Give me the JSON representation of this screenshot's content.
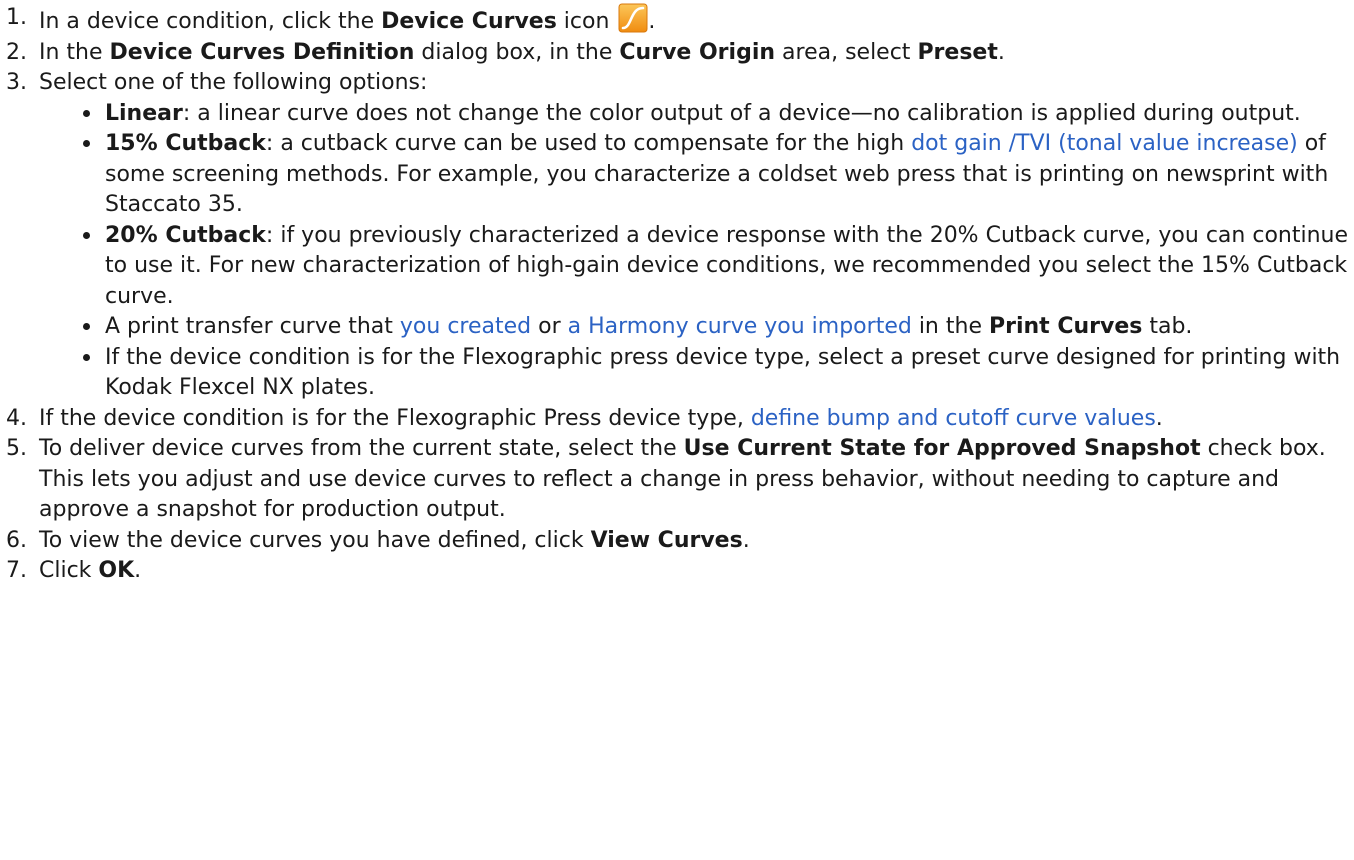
{
  "steps": [
    {
      "num": "1.",
      "t0": "In a device condition, click the ",
      "b0": "Device Curves",
      "t1": " icon ",
      "t2": "."
    },
    {
      "num": "2.",
      "t0": "In the ",
      "b0": "Device Curves Definition",
      "t1": " dialog box, in the ",
      "b1": "Curve Origin",
      "t2": " area, select ",
      "b2": "Preset",
      "t3": "."
    },
    {
      "num": "3.",
      "t0": "Select one of the following options:"
    },
    {
      "num": "4.",
      "t0": "If the device condition is for the Flexographic Press device type, ",
      "link": "define bump and cutoff curve values",
      "t1": "."
    },
    {
      "num": "5.",
      "t0": "To deliver device curves from the current state, select the ",
      "b0": "Use Current State for Approved Snapshot",
      "t1": " check box. This lets you adjust and use device curves to reflect a change in press behavior, without needing to capture and approve a snapshot for production output."
    },
    {
      "num": "6.",
      "t0": "To view the device curves you have defined, click ",
      "b0": "View Curves",
      "t1": "."
    },
    {
      "num": "7.",
      "t0": "Click ",
      "b0": "OK",
      "t1": "."
    }
  ],
  "options": [
    {
      "b0": "Linear",
      "t0": ": a linear curve does not change the color output of a device—no calibration is applied during output."
    },
    {
      "b0": "15% Cutback",
      "t0": ": a cutback curve can be used to compensate for the high ",
      "link": "dot gain /TVI (tonal value increase)",
      "t1": " of some screening methods. For example, you characterize a coldset web press that is printing on newsprint with Staccato 35."
    },
    {
      "b0": "20% Cutback",
      "t0": ": if you previously characterized a device response with the 20% Cutback curve, you can continue to use it. For new characterization of high-gain device conditions, we recommended you select the 15% Cutback curve."
    },
    {
      "t0": "A print transfer curve that ",
      "link0": "you created",
      "t1": " or ",
      "link1": "a Harmony curve you imported",
      "t2": " in the ",
      "b0": "Print Curves",
      "t3": " tab."
    },
    {
      "t0": "If the device condition is for the Flexographic press device type, select a preset curve designed for printing with Kodak Flexcel NX plates."
    }
  ],
  "icons": {
    "device_curves": "device-curves-icon"
  },
  "colors": {
    "link": "#2b62c4",
    "icon_fill": "#f7a21b"
  }
}
